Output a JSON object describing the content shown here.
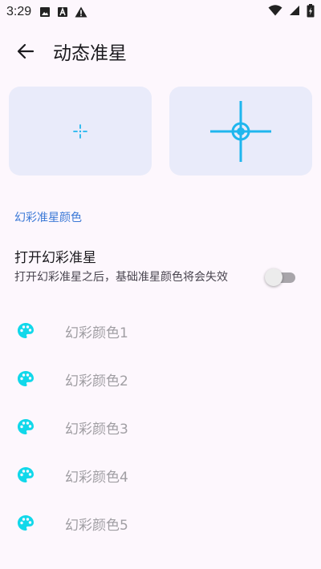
{
  "status_bar": {
    "time": "3:29",
    "icons": [
      "image-icon",
      "a-box-icon",
      "warning-icon",
      "wifi-icon",
      "signal-icon",
      "battery-charging-icon"
    ]
  },
  "app_bar": {
    "title": "动态准星",
    "back_icon": "arrow-left-icon"
  },
  "previews": {
    "accent": "#1fb6ee",
    "items": [
      "small-crosshair",
      "scope-crosshair"
    ]
  },
  "section": {
    "header": "幻彩准星颜色",
    "accent": "#3a78d6"
  },
  "rainbow_switch": {
    "title": "打开幻彩准星",
    "description": "打开幻彩准星之后，基础准星颜色将会失效",
    "enabled": false
  },
  "colors": {
    "icon": "palette-icon",
    "icon_color": "#11d8ea",
    "items": [
      {
        "label": "幻彩颜色1"
      },
      {
        "label": "幻彩颜色2"
      },
      {
        "label": "幻彩颜色3"
      },
      {
        "label": "幻彩颜色4"
      },
      {
        "label": "幻彩颜色5"
      }
    ]
  }
}
